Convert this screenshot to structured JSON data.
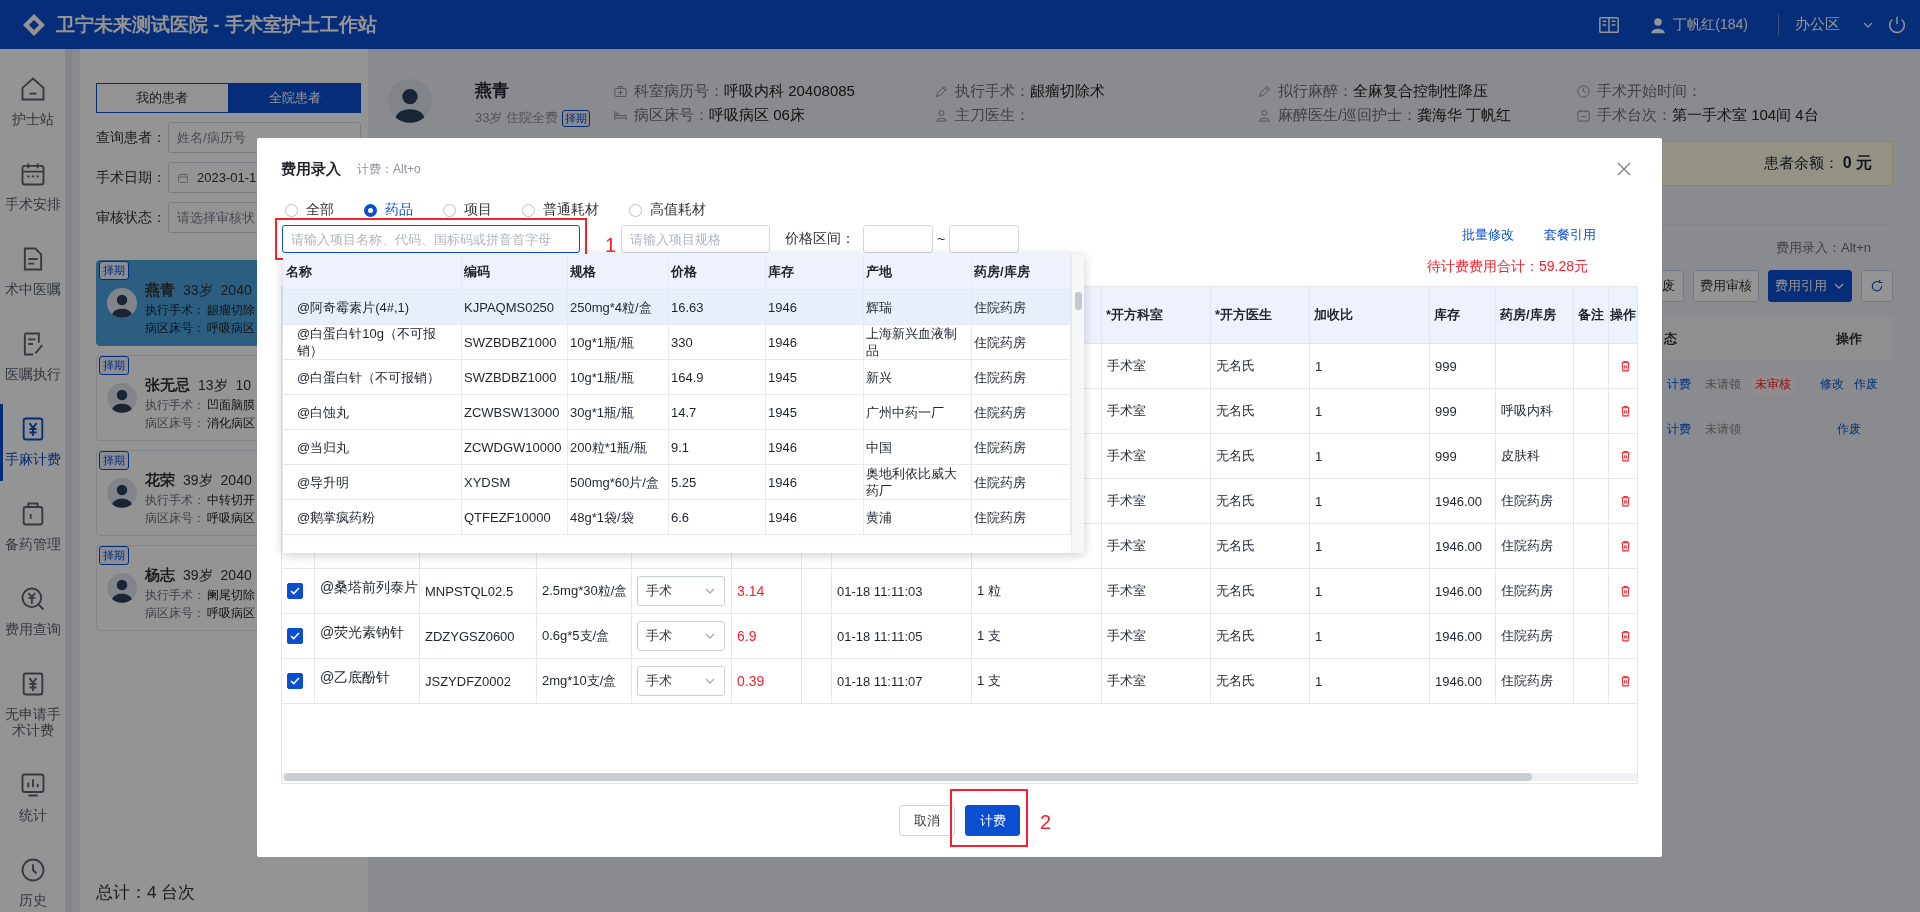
{
  "header": {
    "title": "卫宁未来测试医院 - 手术室护士工作站",
    "user": "丁帆红(184)",
    "area": "办公区"
  },
  "sidebar": {
    "items": [
      {
        "label": "护士站",
        "kind": "home",
        "selected": false
      },
      {
        "label": "手术安排",
        "kind": "calendar",
        "selected": false
      },
      {
        "label": "术中医嘱",
        "kind": "doc",
        "selected": false
      },
      {
        "label": "医嘱执行",
        "kind": "edit",
        "selected": false
      },
      {
        "label": "手麻计费",
        "kind": "yen",
        "selected": true
      },
      {
        "label": "备药管理",
        "kind": "bag",
        "selected": false
      },
      {
        "label": "费用查询",
        "kind": "coin",
        "selected": false
      },
      {
        "label": "无申请手术计费",
        "kind": "yen",
        "selected": false
      },
      {
        "label": "统计",
        "kind": "chart",
        "selected": false
      },
      {
        "label": "历史",
        "kind": "clock",
        "selected": false
      }
    ]
  },
  "patient_panel": {
    "tabs": [
      {
        "label": "我的患者",
        "selected": false
      },
      {
        "label": "全院患者",
        "selected": true
      }
    ],
    "filters": [
      {
        "label": "查询患者：",
        "kind": "search",
        "placeholder": "姓名/病历号"
      },
      {
        "label": "手术日期：",
        "kind": "date",
        "value": "2023-01-1"
      },
      {
        "label": "审核状态：",
        "kind": "select",
        "placeholder": "请选择审核状"
      }
    ],
    "patients": [
      {
        "tag": "择期",
        "name": "燕青",
        "age": "33岁",
        "id": "2040",
        "surgery_label": "执行手术：",
        "surgery": "龈瘤切除",
        "ward_label": "病区床号：",
        "ward": "呼吸病区",
        "selected": true
      },
      {
        "tag": "择期",
        "name": "张无忌",
        "age": "13岁",
        "id": "10",
        "surgery_label": "执行手术：",
        "surgery": "凹面脑膜",
        "ward_label": "病区床号：",
        "ward": "消化病区",
        "selected": false
      },
      {
        "tag": "择期",
        "name": "花荣",
        "age": "39岁",
        "id": "2040",
        "surgery_label": "执行手术：",
        "surgery": "中转切开",
        "ward_label": "病区床号：",
        "ward": "呼吸病区",
        "selected": false
      },
      {
        "tag": "择期",
        "name": "杨志",
        "age": "39岁",
        "id": "2040",
        "surgery_label": "执行手术：",
        "surgery": "阑尾切除",
        "ward_label": "病区床号：",
        "ward": "呼吸病区",
        "selected": false
      }
    ],
    "total": "总计：4 台次"
  },
  "patient": {
    "name": "燕青",
    "info": "33岁 住院全费",
    "tag": "择期",
    "fields": [
      {
        "kind": "kit",
        "label": "科室病历号：",
        "value": "呼吸内科 20408085"
      },
      {
        "kind": "bed",
        "label": "病区床号：",
        "value": "呼吸病区 06床"
      },
      {
        "kind": "pen",
        "label": "执行手术：",
        "value": "龈瘤切除术"
      },
      {
        "kind": "person",
        "label": "主刀医生："
      },
      {
        "kind": "pen",
        "label": "拟行麻醉：",
        "value": "全麻复合控制性降压"
      },
      {
        "kind": "person",
        "label": "麻醉医生/巡回护士：",
        "value": "龚海华 丁帆红"
      },
      {
        "kind": "clock",
        "label": "手术开始时间："
      },
      {
        "kind": "calendar",
        "label": "手术台次：",
        "value": "第一手术室 104间 4台"
      }
    ]
  },
  "balance": {
    "label": "患者余额：",
    "value": "0 元"
  },
  "billing_bar": {
    "shortcut": "费用录入：Alt+n",
    "buttons": [
      {
        "label": "废",
        "kind": "default"
      },
      {
        "label": "费用审核",
        "kind": "default"
      },
      {
        "label": "费用引用",
        "kind": "primary"
      }
    ]
  },
  "record_table": {
    "columns": [
      "态",
      "操作"
    ],
    "rows": [
      {
        "status": [
          {
            "text": "计费",
            "kind": "info"
          },
          {
            "text": "未请领",
            "kind": "muted"
          },
          {
            "text": "未审核",
            "kind": "alert"
          }
        ],
        "actions": [
          "修改",
          "作废"
        ]
      },
      {
        "status": [
          {
            "text": "计费",
            "kind": "info"
          },
          {
            "text": "未请领",
            "kind": "muted"
          }
        ],
        "actions": [
          "作废"
        ]
      }
    ]
  },
  "dialog": {
    "title": "费用录入",
    "shortcut": "计费：Alt+o",
    "categories": [
      {
        "label": "全部",
        "selected": false
      },
      {
        "label": "药品",
        "selected": true
      },
      {
        "label": "项目",
        "selected": false
      },
      {
        "label": "普通耗材",
        "selected": false
      },
      {
        "label": "高值耗材",
        "selected": false
      }
    ],
    "search": {
      "placeholder": "请输入项目名称、代码、国标码或拼音首字母"
    },
    "spec": {
      "placeholder": "请输入项目规格"
    },
    "price_label": "价格区间：",
    "range_sep": "~",
    "links": [
      "批量修改",
      "套餐引用"
    ],
    "total": "待计费费用合计：59.28元",
    "suggestions": {
      "columns": [
        "名称",
        "编码",
        "规格",
        "价格",
        "库存",
        "产地",
        "药房/库房"
      ],
      "rows": [
        {
          "cells": [
            "@阿奇霉素片(4#,1)",
            "KJPAQMS0250",
            "250mg*4粒/盒",
            "16.63",
            "1946",
            "辉瑞",
            "住院药房"
          ],
          "selected": true
        },
        {
          "cells": [
            "@白蛋白针10g（不可报销）",
            "SWZBDBZ1000",
            "10g*1瓶/瓶",
            "330",
            "1946",
            "上海新兴血液制品",
            "住院药房"
          ],
          "selected": false
        },
        {
          "cells": [
            "@白蛋白针（不可报销）",
            "SWZBDBZ1000",
            "10g*1瓶/瓶",
            "164.9",
            "1945",
            "新兴",
            "住院药房"
          ],
          "selected": false
        },
        {
          "cells": [
            "@白蚀丸",
            "ZCWBSW13000",
            "30g*1瓶/瓶",
            "14.7",
            "1945",
            "广州中药一厂",
            "住院药房"
          ],
          "selected": false
        },
        {
          "cells": [
            "@当归丸",
            "ZCWDGW10000",
            "200粒*1瓶/瓶",
            "9.1",
            "1946",
            "中国",
            "住院药房"
          ],
          "selected": false
        },
        {
          "cells": [
            "@导升明",
            "XYDSM",
            "500mg*60片/盒",
            "5.25",
            "1946",
            "奥地利依比威大药厂",
            "住院药房"
          ],
          "selected": false
        },
        {
          "cells": [
            "@鹅掌疯药粉",
            "QTFEZF10000",
            "48g*1袋/袋",
            "6.6",
            "1946",
            "黄浦",
            "住院药房"
          ],
          "selected": false
        }
      ]
    },
    "table": {
      "columns": [
        "*开方科室",
        "*开方医生",
        "加收比",
        "库存",
        "药房/库房",
        "备注",
        "操作"
      ],
      "rows": [
        {
          "dept": "手术室",
          "doctor": "无名氏",
          "ratio": "1",
          "stock": "999"
        },
        {
          "dept": "手术室",
          "doctor": "无名氏",
          "ratio": "1",
          "stock": "999",
          "pharmacy": "呼吸内科"
        },
        {
          "dept": "手术室",
          "doctor": "无名氏",
          "ratio": "1",
          "stock": "999",
          "pharmacy": "皮肤科"
        },
        {
          "dept": "手术室",
          "doctor": "无名氏",
          "ratio": "1",
          "stock": "1946.00",
          "pharmacy": "住院药房"
        },
        {
          "dept": "手术室",
          "doctor": "无名氏",
          "ratio": "1",
          "stock": "1946.00",
          "pharmacy": "住院药房"
        },
        {
          "checked": true,
          "name": "@桑塔前列泰片",
          "code": "MNPSTQL02.5",
          "spec": "2.5mg*30粒/盒",
          "category": "手术",
          "price": "3.14",
          "time": "01-18 11:11:03",
          "qty": "1 粒",
          "dept": "手术室",
          "doctor": "无名氏",
          "ratio": "1",
          "stock": "1946.00",
          "pharmacy": "住院药房"
        },
        {
          "checked": true,
          "name": "@荧光素钠针",
          "code": "ZDZYGSZ0600",
          "spec": "0.6g*5支/盒",
          "category": "手术",
          "price": "6.9",
          "time": "01-18 11:11:05",
          "qty": "1 支",
          "dept": "手术室",
          "doctor": "无名氏",
          "ratio": "1",
          "stock": "1946.00",
          "pharmacy": "住院药房"
        },
        {
          "checked": true,
          "name": "@乙底酚针",
          "code": "JSZYDFZ0002",
          "spec": "2mg*10支/盒",
          "category": "手术",
          "price": "0.39",
          "time": "01-18 11:11:07",
          "qty": "1 支",
          "dept": "手术室",
          "doctor": "无名氏",
          "ratio": "1",
          "stock": "1946.00",
          "pharmacy": "住院药房"
        }
      ]
    },
    "buttons": [
      {
        "label": "取消",
        "kind": "default"
      },
      {
        "label": "计费",
        "kind": "primary"
      }
    ],
    "annotations": [
      "1",
      "2"
    ]
  }
}
